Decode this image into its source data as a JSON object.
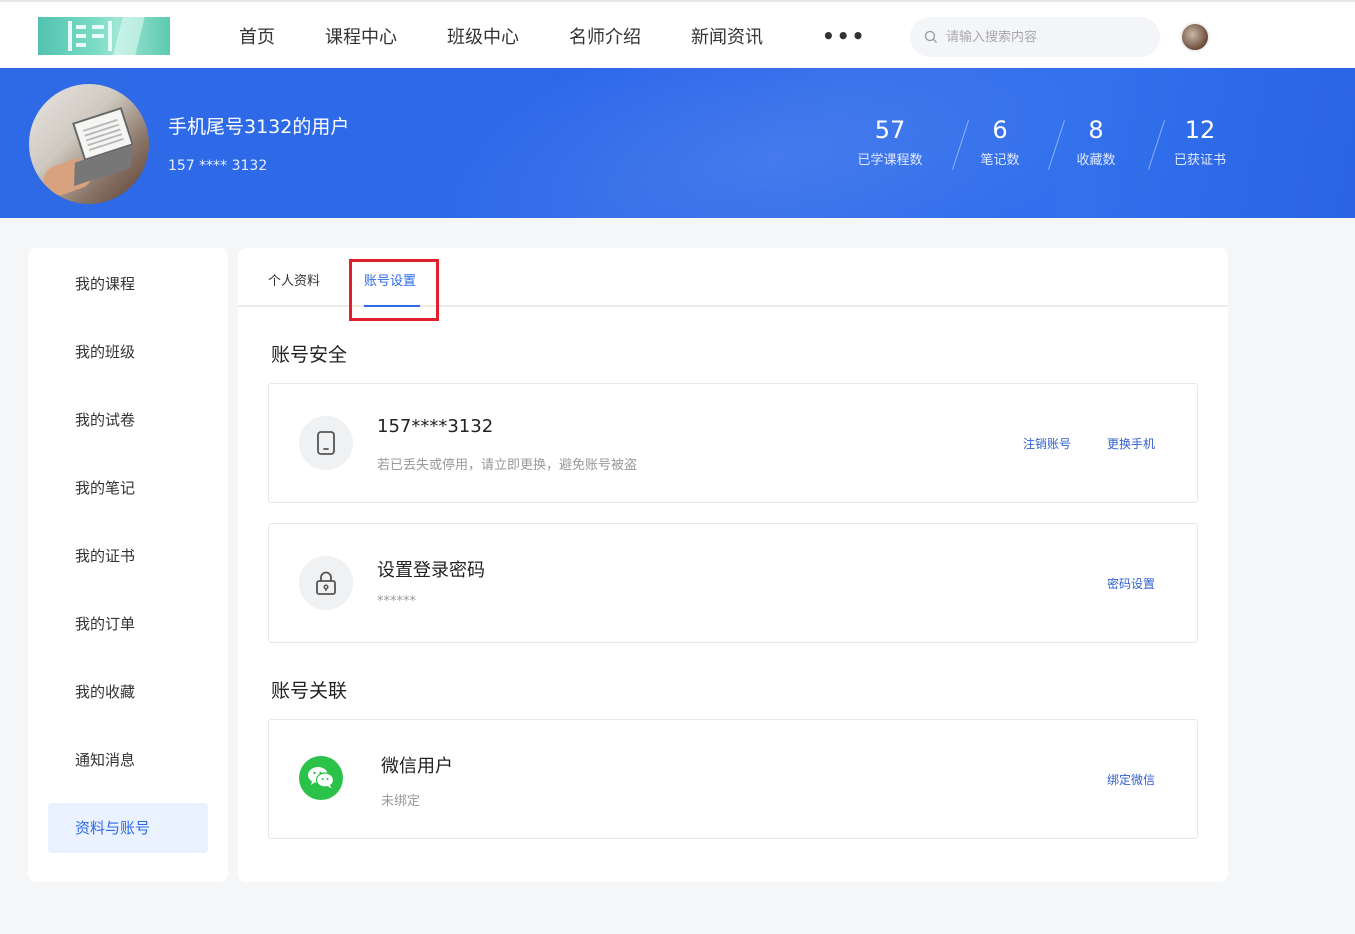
{
  "nav": {
    "links": [
      "首页",
      "课程中心",
      "班级中心",
      "名师介绍",
      "新闻资讯"
    ],
    "more": "•••",
    "search_placeholder": "请输入搜索内容"
  },
  "profile": {
    "name": "手机尾号3132的用户",
    "phone": "157 **** 3132",
    "stats": [
      {
        "value": "57",
        "label": "已学课程数"
      },
      {
        "value": "6",
        "label": "笔记数"
      },
      {
        "value": "8",
        "label": "收藏数"
      },
      {
        "value": "12",
        "label": "已获证书"
      }
    ]
  },
  "sidebar": {
    "items": [
      "我的课程",
      "我的班级",
      "我的试卷",
      "我的笔记",
      "我的证书",
      "我的订单",
      "我的收藏",
      "通知消息",
      "资料与账号"
    ],
    "active_index": 8
  },
  "tabs": [
    {
      "label": "个人资料",
      "active": false
    },
    {
      "label": "账号设置",
      "active": true
    }
  ],
  "security": {
    "title": "账号安全",
    "phone_card": {
      "icon": "phone-icon",
      "title": "157****3132",
      "subtitle": "若已丢失或停用，请立即更换，避免账号被盗",
      "actions": [
        "注销账号",
        "更换手机"
      ]
    },
    "password_card": {
      "icon": "lock-icon",
      "title": "设置登录密码",
      "subtitle": "******",
      "action": "密码设置"
    }
  },
  "linking": {
    "title": "账号关联",
    "wechat_card": {
      "icon": "wechat-icon",
      "title": "微信用户",
      "subtitle": "未绑定",
      "action": "绑定微信"
    }
  },
  "colors": {
    "accent": "#2f6ae6",
    "banner": "#2c68ea",
    "highlight": "#e0202c",
    "wechat": "#2bc24a"
  }
}
